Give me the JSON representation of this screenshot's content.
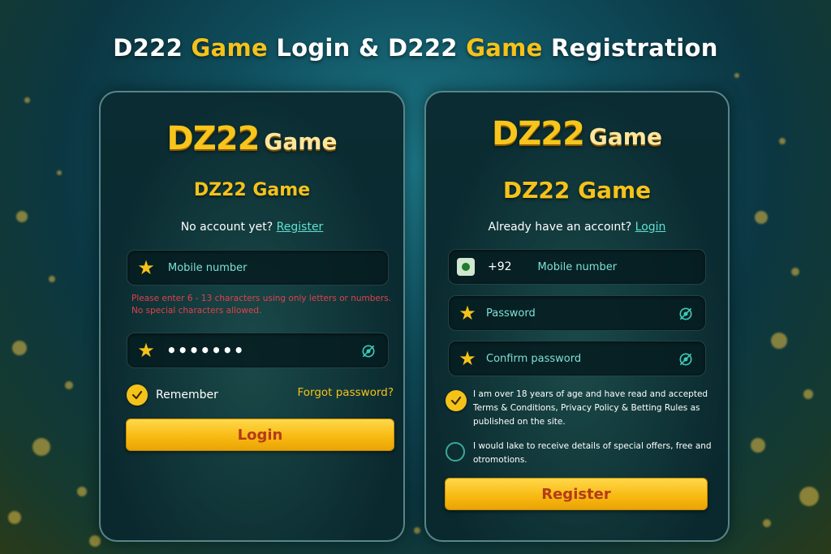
{
  "page": {
    "title_parts": [
      "D222 ",
      "Game",
      " Login & D222 ",
      "Game",
      " Registration"
    ]
  },
  "login": {
    "logo_main": "DZ22",
    "logo_sub": "Game",
    "subtitle": "DZ22 Game",
    "switch_prompt": "No account yet?",
    "switch_link": "Register",
    "mobile_label": "Mobile number",
    "mobile_error": "Please enter 6 - 13 characters using only letters or numbers. No special characters allowed.",
    "password_value": "•••••••",
    "remember_label": "Remember",
    "forgot_label": "Forgot password?",
    "submit_label": "Login"
  },
  "register": {
    "logo_main": "DZ22",
    "logo_sub": "Game",
    "subtitle": "DZ22 Game",
    "switch_prompt": "Already have an accoınt?",
    "switch_link": "Login",
    "country_code": "+92",
    "mobile_label": "Mobile number",
    "password_label": "Password",
    "confirm_label": "Confirm password",
    "agree_text": "I am over 18 years of age and have read and accepted Terms & Conditions, Privacy Policy & Betting Rules as published on the site.",
    "offers_text": "I would lake to receive details of special offers, free and otromotions.",
    "submit_label": "Register"
  },
  "colors": {
    "accent_gold": "#f5c21a",
    "link_teal": "#5fe0d0",
    "error_red": "#e0414b",
    "button_text": "#b53a1a"
  },
  "icons": {
    "field_marker": "star-icon",
    "password_toggle": "eye-off-icon",
    "country_flag": "pakistan-flag-icon",
    "check_on": "checkmark-icon"
  }
}
